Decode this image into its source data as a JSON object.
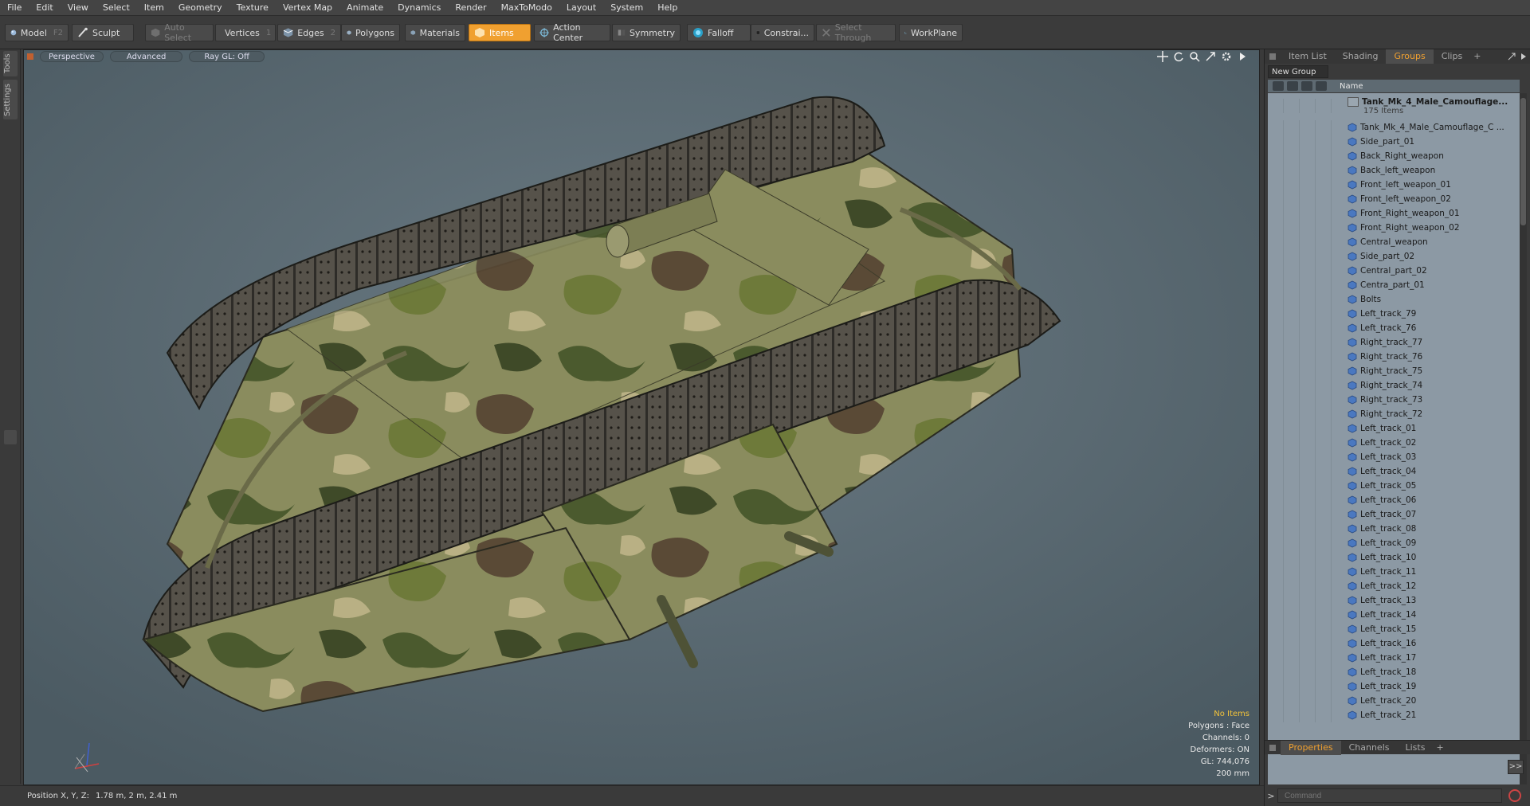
{
  "menu": [
    "File",
    "Edit",
    "View",
    "Select",
    "Item",
    "Geometry",
    "Texture",
    "Vertex Map",
    "Animate",
    "Dynamics",
    "Render",
    "MaxToModo",
    "Layout",
    "System",
    "Help"
  ],
  "toolbar": {
    "model": "Model",
    "model_key": "F2",
    "sculpt": "Sculpt",
    "auto_select": "Auto Select",
    "vertices": "Vertices",
    "vertices_key": "1",
    "edges": "Edges",
    "edges_key": "2",
    "polygons": "Polygons",
    "materials": "Materials",
    "items": "Items",
    "action_center": "Action Center",
    "symmetry": "Symmetry",
    "falloff": "Falloff",
    "constraints": "Constrai...",
    "select_through": "Select Through",
    "workplane": "WorkPlane"
  },
  "left_tabs": [
    "Tools",
    "Settings"
  ],
  "viewport": {
    "view": "Perspective",
    "shading": "Advanced",
    "raygl": "Ray GL: Off",
    "info": {
      "selection": "No Items",
      "polygons": "Polygons : Face",
      "channels": "Channels: 0",
      "deformers": "Deformers: ON",
      "gl": "GL: 744,076",
      "scale": "200 mm"
    }
  },
  "status": {
    "label": "Position X, Y, Z:",
    "value": "1.78 m, 2 m, 2.41 m"
  },
  "right_panel": {
    "tabs": [
      "Item List",
      "Shading",
      "Groups",
      "Clips"
    ],
    "active_tab": "Groups",
    "new_group": "New Group",
    "column_name": "Name",
    "group_name": "Tank_Mk_4_Male_Camouflage...",
    "group_count": "175 Items",
    "items": [
      "Tank_Mk_4_Male_Camouflage_C ...",
      "Side_part_01",
      "Back_Right_weapon",
      "Back_left_weapon",
      "Front_left_weapon_01",
      "Front_left_weapon_02",
      "Front_Right_weapon_01",
      "Front_Right_weapon_02",
      "Central_weapon",
      "Side_part_02",
      "Central_part_02",
      "Centra_part_01",
      "Bolts",
      "Left_track_79",
      "Left_track_76",
      "Right_track_77",
      "Right_track_76",
      "Right_track_75",
      "Right_track_74",
      "Right_track_73",
      "Right_track_72",
      "Left_track_01",
      "Left_track_02",
      "Left_track_03",
      "Left_track_04",
      "Left_track_05",
      "Left_track_06",
      "Left_track_07",
      "Left_track_08",
      "Left_track_09",
      "Left_track_10",
      "Left_track_11",
      "Left_track_12",
      "Left_track_13",
      "Left_track_14",
      "Left_track_15",
      "Left_track_16",
      "Left_track_17",
      "Left_track_18",
      "Left_track_19",
      "Left_track_20",
      "Left_track_21"
    ],
    "bottom_tabs": [
      "Properties",
      "Channels",
      "Lists"
    ],
    "active_bottom_tab": "Properties",
    "expand": ">>",
    "command_prompt": ">",
    "command_placeholder": "Command"
  },
  "colors": {
    "accent": "#f0a030",
    "viewport_bg": "#5a6a72",
    "list_bg": "#8c99a4",
    "info_highlight": "#f2c23a"
  }
}
